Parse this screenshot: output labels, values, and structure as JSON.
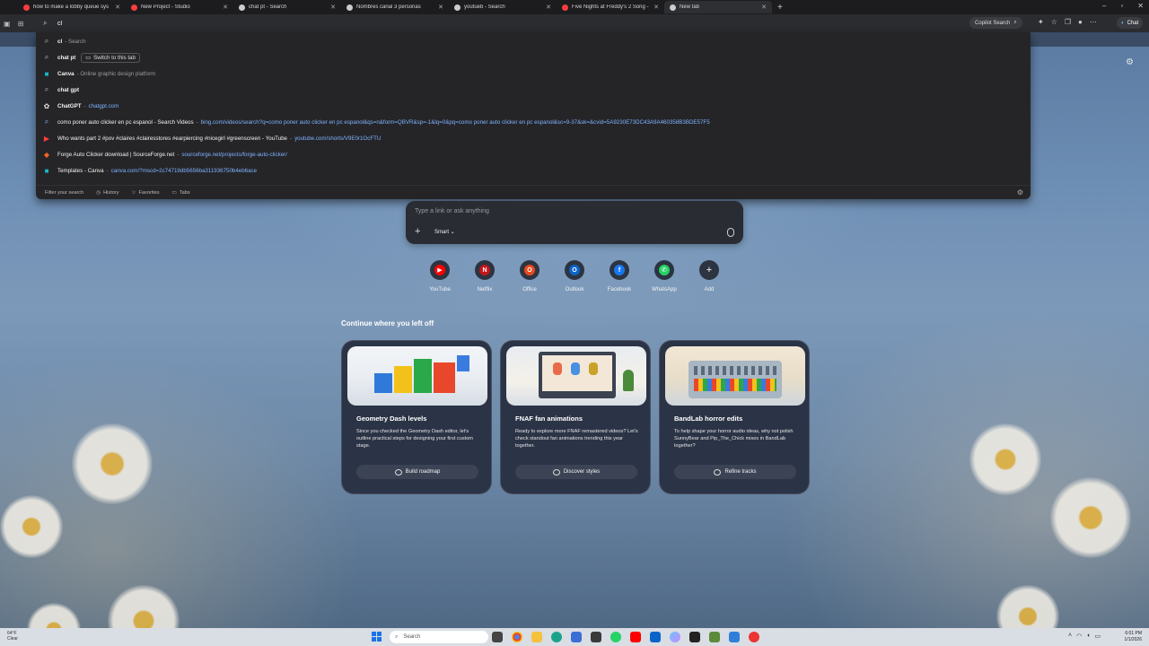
{
  "tabs": [
    {
      "title": "how to make a lobby queue sys",
      "color": "#ff3d3d",
      "active": false
    },
    {
      "title": "New Project - Studio",
      "color": "#ff3d3d",
      "active": false
    },
    {
      "title": "chat pt - Search",
      "color": "#cccccc",
      "active": false
    },
    {
      "title": "Nombres canal 3 personas",
      "color": "#cccccc",
      "active": false
    },
    {
      "title": "youtueb - Search",
      "color": "#cccccc",
      "active": false
    },
    {
      "title": "Five Nights at Freddy's 2 Song -",
      "color": "#ff3d3d",
      "active": false
    },
    {
      "title": "New tab",
      "color": "#cccccc",
      "active": true
    }
  ],
  "address": {
    "value": "cl"
  },
  "toolbar": {
    "copilot_search": "Copilot Search",
    "chat": "Chat"
  },
  "suggestions": [
    {
      "main_bold": "cl",
      "main": "",
      "sub": "- Search",
      "url": "",
      "icon": "search-icon",
      "type": "search"
    },
    {
      "main_bold": "chat pt",
      "main": "",
      "sub": "",
      "url": "",
      "icon": "search-icon",
      "type": "switch",
      "switch_label": "Switch to this tab"
    },
    {
      "main_bold": "Canva",
      "main": "",
      "sub": "- Online graphic design platform",
      "url": "",
      "icon": "canva-icon",
      "type": "site"
    },
    {
      "main_bold": "chat gpt",
      "main": "",
      "sub": "",
      "url": "",
      "icon": "search-icon",
      "type": "search"
    },
    {
      "main_bold": "ChatGPT",
      "main": "",
      "sub": "-",
      "url": "chatgpt.com",
      "icon": "chatgpt-icon",
      "type": "site"
    },
    {
      "main_bold": "",
      "main": "como poner auto clicker en pc espanol - Search Videos",
      "sub": "-",
      "url": "bing.com/videos/search?q=como poner auto clicker en pc espanol&qs=n&form=QBVR&sp=-1&lq=0&pq=como poner auto clicker en pc espanol&sc=9-37&sk=&cvid=5A9230E73DC43A9A460358B3BDE57F5",
      "icon": "bing-search-icon",
      "type": "history"
    },
    {
      "main_bold": "",
      "main": "Who wants part 2 #pov #claires #clairesstores #earpiercing #nicegirl #greenscreen - YouTube",
      "sub": "-",
      "url": "youtube.com/shorts/V9E0r1OcFTU",
      "icon": "youtube-icon",
      "type": "history"
    },
    {
      "main_bold": "",
      "main": "Forge Auto Clicker download | SourceForge.net",
      "sub": "-",
      "url": "sourceforge.net/projects/forge-auto-clicker/",
      "icon": "sourceforge-icon",
      "type": "history"
    },
    {
      "main_bold": "",
      "main": "Templates - Canva",
      "sub": "-",
      "url": "canva.com/?mscd=2c74719db5656ba311936750b4eb6ace",
      "icon": "canva-icon",
      "type": "history"
    }
  ],
  "dropdown_footer": {
    "filter": "Filter your search",
    "history": "History",
    "favorites": "Favorites",
    "tabs": "Tabs"
  },
  "ntp": {
    "search_placeholder": "Type a link or ask anything",
    "mode": "Smart",
    "quick_links": [
      {
        "label": "YouTube",
        "color": "#ff0000",
        "glyph": "▶"
      },
      {
        "label": "Netflix",
        "color": "#c4161c",
        "glyph": "N"
      },
      {
        "label": "Office",
        "color": "#e8491d",
        "glyph": "O"
      },
      {
        "label": "Outlook",
        "color": "#0a64c8",
        "glyph": "O"
      },
      {
        "label": "Facebook",
        "color": "#1877f2",
        "glyph": "f"
      },
      {
        "label": "WhatsApp",
        "color": "#25d366",
        "glyph": "✆"
      },
      {
        "label": "Add",
        "color": "transparent",
        "glyph": "+"
      }
    ],
    "continue_title": "Continue where you left off",
    "cards": [
      {
        "title": "Geometry Dash levels",
        "desc": "Since you checked the Geometry Dash editor, let's outline practical steps for designing your first custom stage.",
        "action": "Build roadmap"
      },
      {
        "title": "FNAF fan animations",
        "desc": "Ready to explore more FNAF remastered videos? Let's check standout fan animations trending this year together.",
        "action": "Discover styles"
      },
      {
        "title": "BandLab horror edits",
        "desc": "To help shape your horror audio ideas, why not polish SunnyBear and Pip_The_Chick mixes in BandLab together?",
        "action": "Refine tracks"
      }
    ]
  },
  "taskbar": {
    "weather_temp": "64°F",
    "weather_desc": "Clear",
    "search": "Search",
    "time": "6:01 PM",
    "date": "1/1/2026"
  }
}
